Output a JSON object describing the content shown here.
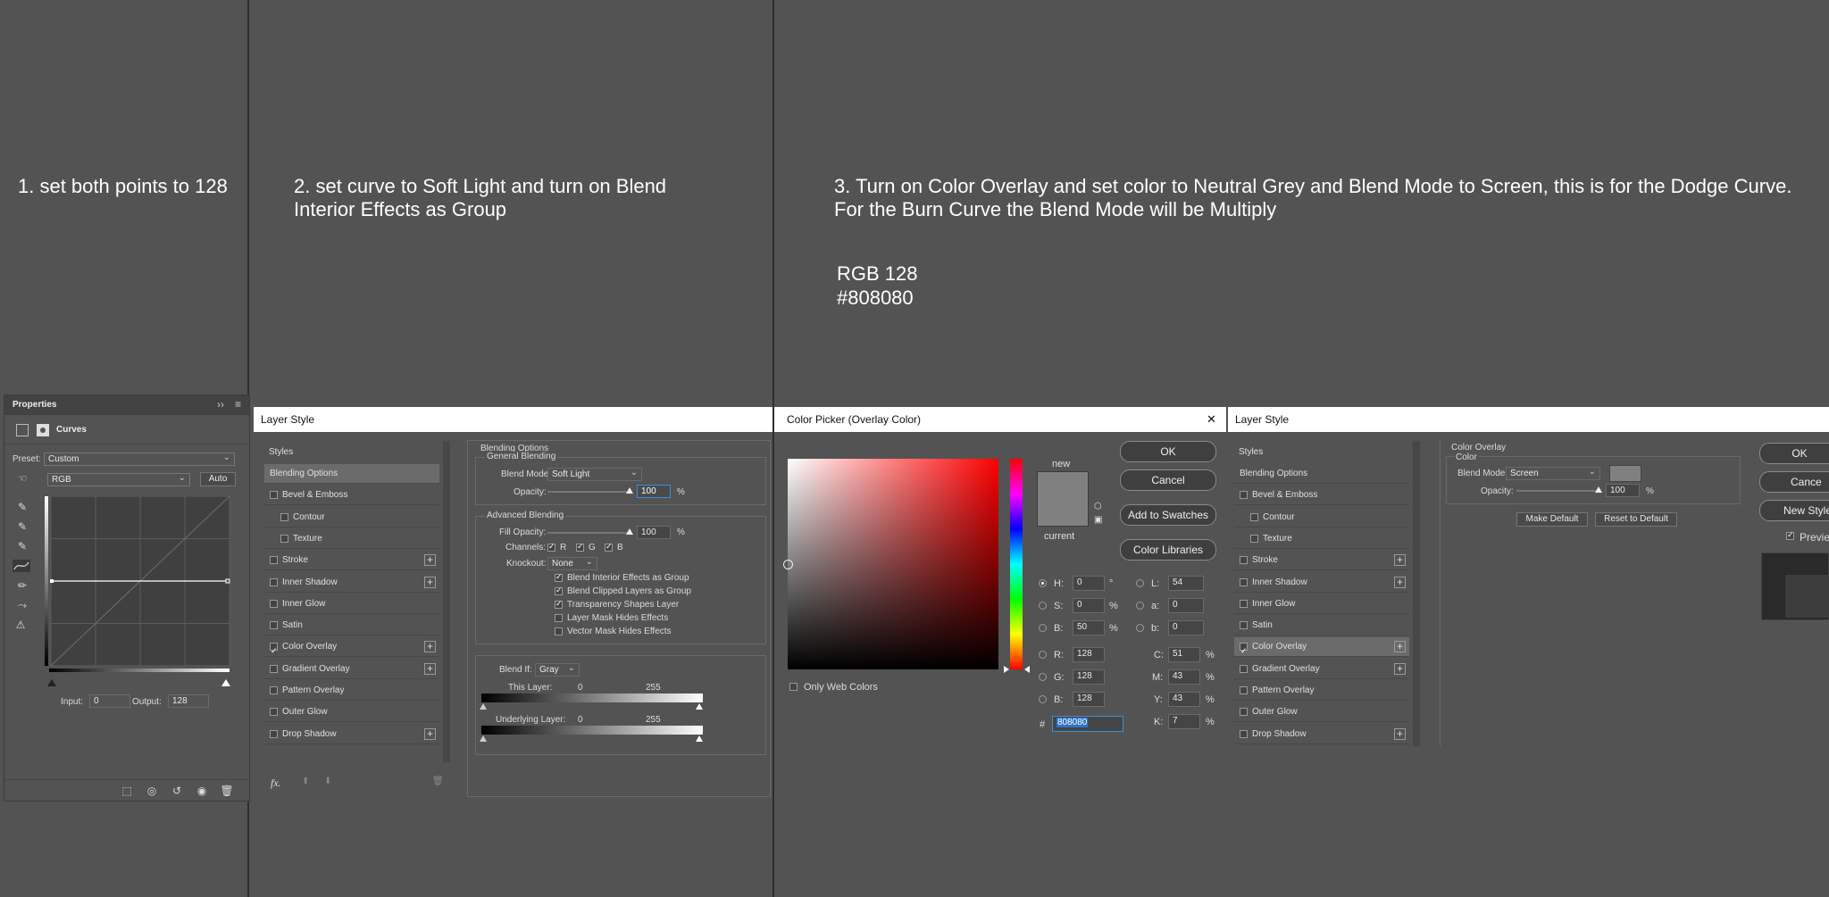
{
  "instructions": {
    "step1": "1. set both points to 128",
    "step2": "2. set curve to Soft Light and turn on Blend\nInterior Effects as Group",
    "step3": "3. Turn on Color Overlay and set color to Neutral Grey and Blend Mode to Screen, this is for the Dodge Curve.\nFor the Burn Curve the Blend Mode will be Multiply",
    "rgb": "RGB 128",
    "hex": "#808080"
  },
  "properties": {
    "tab": "Properties",
    "collapse": "››",
    "menu": "≡",
    "title": "Curves",
    "preset_label": "Preset:",
    "preset_value": "Custom",
    "channel_value": "RGB",
    "auto_label": "Auto",
    "input_label": "Input:",
    "input_value": "0",
    "output_label": "Output:",
    "output_value": "128"
  },
  "layer_style": {
    "title": "Layer Style",
    "styles_header": "Styles",
    "items": [
      {
        "label": "Blending Options",
        "checkbox": false,
        "checked": false,
        "plus": false,
        "indent": false,
        "selected": true
      },
      {
        "label": "Bevel & Emboss",
        "checkbox": true,
        "checked": false,
        "plus": false,
        "indent": false,
        "selected": false
      },
      {
        "label": "Contour",
        "checkbox": true,
        "checked": false,
        "plus": false,
        "indent": true,
        "selected": false
      },
      {
        "label": "Texture",
        "checkbox": true,
        "checked": false,
        "plus": false,
        "indent": true,
        "selected": false
      },
      {
        "label": "Stroke",
        "checkbox": true,
        "checked": false,
        "plus": true,
        "indent": false,
        "selected": false
      },
      {
        "label": "Inner Shadow",
        "checkbox": true,
        "checked": false,
        "plus": true,
        "indent": false,
        "selected": false
      },
      {
        "label": "Inner Glow",
        "checkbox": true,
        "checked": false,
        "plus": false,
        "indent": false,
        "selected": false
      },
      {
        "label": "Satin",
        "checkbox": true,
        "checked": false,
        "plus": false,
        "indent": false,
        "selected": false
      },
      {
        "label": "Color Overlay",
        "checkbox": true,
        "checked": true,
        "plus": true,
        "indent": false,
        "selected": false
      },
      {
        "label": "Gradient Overlay",
        "checkbox": true,
        "checked": false,
        "plus": true,
        "indent": false,
        "selected": false
      },
      {
        "label": "Pattern Overlay",
        "checkbox": true,
        "checked": false,
        "plus": false,
        "indent": false,
        "selected": false
      },
      {
        "label": "Outer Glow",
        "checkbox": true,
        "checked": false,
        "plus": false,
        "indent": false,
        "selected": false
      },
      {
        "label": "Drop Shadow",
        "checkbox": true,
        "checked": false,
        "plus": true,
        "indent": false,
        "selected": false
      }
    ],
    "fx": "fx.",
    "blending": {
      "header": "Blending Options",
      "general": "General Blending",
      "blend_mode_label": "Blend Mode:",
      "blend_mode_value": "Soft Light",
      "opacity_label": "Opacity:",
      "opacity_value": "100",
      "percent": "%",
      "advanced": "Advanced Blending",
      "fill_opacity_label": "Fill Opacity:",
      "fill_opacity_value": "100",
      "channels_label": "Channels:",
      "ch_r": "R",
      "ch_g": "G",
      "ch_b": "B",
      "knockout_label": "Knockout:",
      "knockout_value": "None",
      "options": [
        {
          "label": "Blend Interior Effects as Group",
          "checked": true
        },
        {
          "label": "Blend Clipped Layers as Group",
          "checked": true
        },
        {
          "label": "Transparency Shapes Layer",
          "checked": true
        },
        {
          "label": "Layer Mask Hides Effects",
          "checked": false
        },
        {
          "label": "Vector Mask Hides Effects",
          "checked": false
        }
      ],
      "blend_if_label": "Blend If:",
      "blend_if_value": "Gray",
      "this_layer": "This Layer:",
      "underlying_layer": "Underlying Layer:",
      "low": "0",
      "high": "255"
    }
  },
  "color_picker": {
    "title": "Color Picker (Overlay Color)",
    "close": "✕",
    "new_label": "new",
    "current_label": "current",
    "ok": "OK",
    "cancel": "Cancel",
    "add_swatches": "Add to Swatches",
    "color_libraries": "Color Libraries",
    "only_web": "Only Web Colors",
    "swatch_color": "#808080",
    "h_label": "H:",
    "h_value": "0",
    "h_unit": "°",
    "s_label": "S:",
    "s_value": "0",
    "s_unit": "%",
    "bv_label": "B:",
    "bv_value": "50",
    "bv_unit": "%",
    "r_label": "R:",
    "r_value": "128",
    "g_label": "G:",
    "g_value": "128",
    "b_label": "B:",
    "b_value": "128",
    "l_label": "L:",
    "l_value": "54",
    "a_label": "a:",
    "a_value": "0",
    "lb_label": "b:",
    "lb_value": "0",
    "c_label": "C:",
    "c_value": "51",
    "m_label": "M:",
    "m_value": "43",
    "y_label": "Y:",
    "y_value": "43",
    "k_label": "K:",
    "k_value": "7",
    "pct": "%",
    "hash": "#",
    "hex_value": "808080"
  },
  "layer_style2": {
    "title": "Layer Style",
    "overlay_header": "Color Overlay",
    "color_sub": "Color",
    "blend_mode_label": "Blend Mode:",
    "blend_mode_value": "Screen",
    "opacity_label": "Opacity:",
    "opacity_value": "100",
    "percent": "%",
    "make_default": "Make Default",
    "reset_default": "Reset to Default",
    "ok": "OK",
    "cancel": "Cance",
    "new_style": "New Style",
    "preview": "Previe"
  }
}
